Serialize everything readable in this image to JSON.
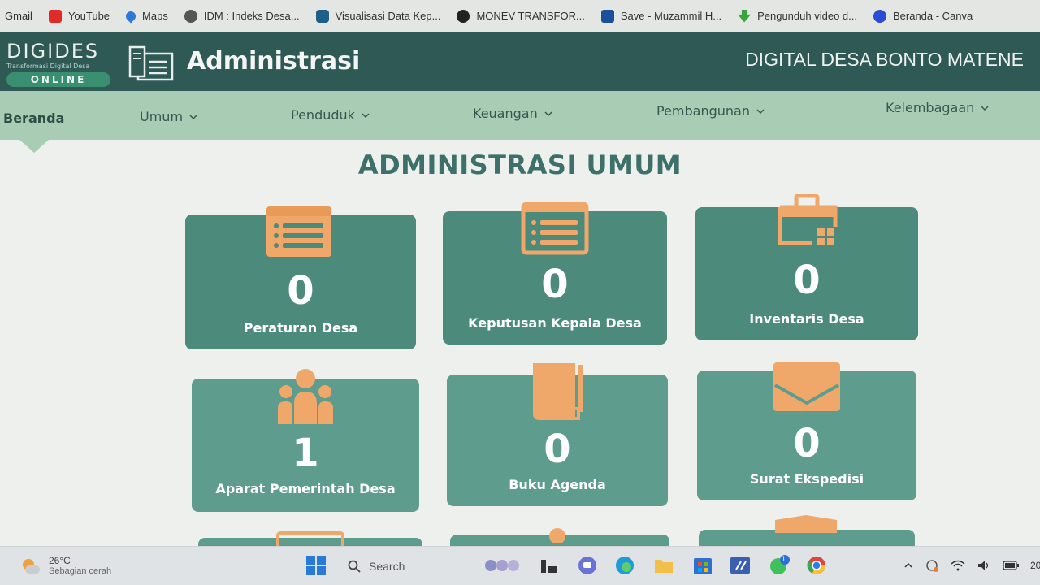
{
  "bookmarks": [
    {
      "label": "Gmail",
      "icon": "gmail-icon"
    },
    {
      "label": "YouTube",
      "icon": "youtube-icon"
    },
    {
      "label": "Maps",
      "icon": "maps-icon"
    },
    {
      "label": "IDM : Indeks Desa...",
      "icon": "idm-icon"
    },
    {
      "label": "Visualisasi Data Kep...",
      "icon": "visualisasi-icon"
    },
    {
      "label": "MONEV TRANSFOR...",
      "icon": "monev-icon"
    },
    {
      "label": "Save - Muzammil H...",
      "icon": "download-icon"
    },
    {
      "label": "Pengunduh video d...",
      "icon": "video-download-icon"
    },
    {
      "label": "Beranda - Canva",
      "icon": "canva-icon"
    }
  ],
  "header": {
    "logo_title": "DIGIDES",
    "logo_subtitle": "Transformasi Digital Desa",
    "logo_badge": "ONLINE",
    "title": "Administrasi",
    "village": "DIGITAL DESA BONTO MATENE"
  },
  "nav": {
    "items": [
      {
        "label": "Beranda"
      },
      {
        "label": "Umum"
      },
      {
        "label": "Penduduk"
      },
      {
        "label": "Keuangan"
      },
      {
        "label": "Pembangunan"
      },
      {
        "label": "Kelembagaan"
      }
    ]
  },
  "main": {
    "section_title": "ADMINISTRASI UMUM",
    "cards": [
      {
        "label": "Peraturan Desa",
        "count": "0",
        "icon": "list-document-icon"
      },
      {
        "label": "Keputusan Kepala Desa",
        "count": "0",
        "icon": "list-document-icon"
      },
      {
        "label": "Inventaris Desa",
        "count": "0",
        "icon": "inventory-briefcase-icon"
      },
      {
        "label": "Aparat Pemerintah Desa",
        "count": "1",
        "icon": "people-group-icon"
      },
      {
        "label": "Buku Agenda",
        "count": "0",
        "icon": "book-icon"
      },
      {
        "label": "Surat Ekspedisi",
        "count": "0",
        "icon": "envelope-icon"
      }
    ]
  },
  "taskbar": {
    "weather_temp": "26°C",
    "weather_desc": "Sebagian cerah",
    "search_placeholder": "Search",
    "time": "20",
    "whatsapp_badge": "1"
  },
  "colors": {
    "header_bg": "#2f5954",
    "nav_bg": "#a9cdb4",
    "card_bg": "#4c8a7c",
    "icon_orange": "#f0a86a",
    "title_teal": "#3d7068"
  }
}
